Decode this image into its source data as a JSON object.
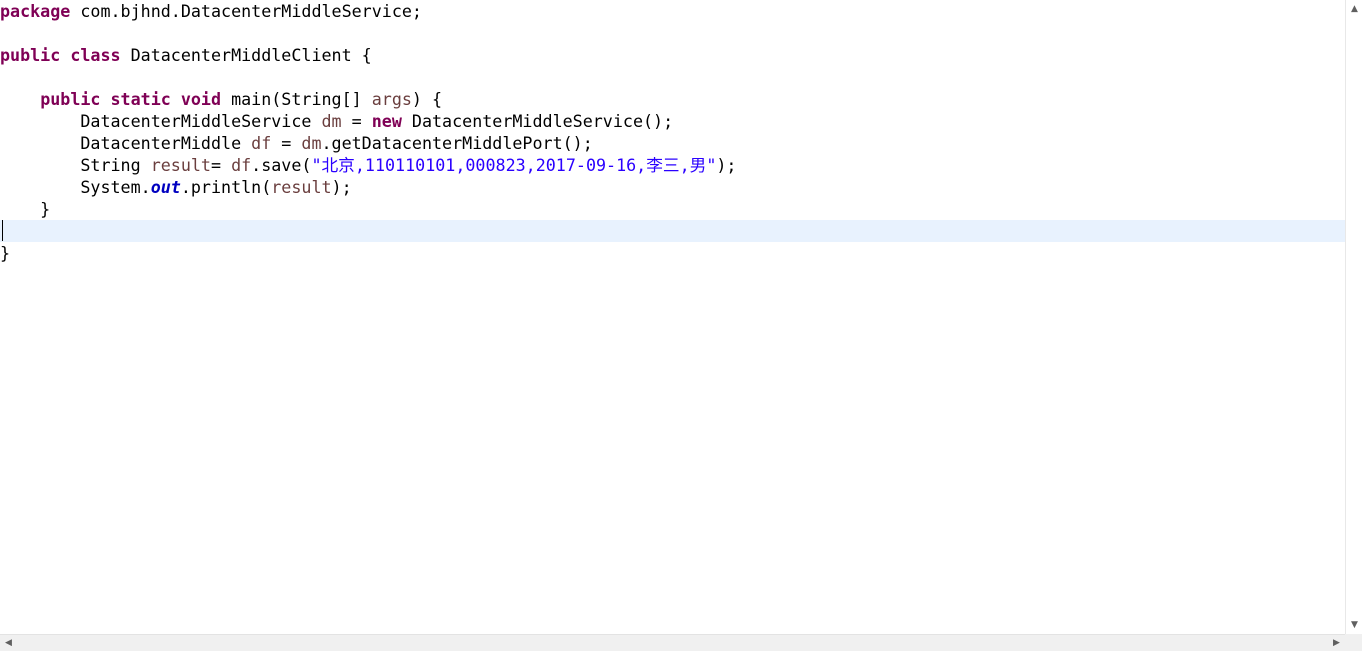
{
  "code": {
    "line1": {
      "kw": "package",
      "rest": " com.bjhnd.DatacenterMiddleService;"
    },
    "line3": {
      "kw1": "public",
      "kw2": "class",
      "rest": " DatacenterMiddleClient {"
    },
    "line5": {
      "indent": "    ",
      "kw1": "public",
      "kw2": "static",
      "kw3": "void",
      "mid": " main(String[] ",
      "var": "args",
      "end": ") {"
    },
    "line6": {
      "indent": "        ",
      "type": "DatacenterMiddleService ",
      "var": "dm",
      "eq": " = ",
      "kw": "new",
      "end": " DatacenterMiddleService();"
    },
    "line7": {
      "indent": "        ",
      "type": "DatacenterMiddle ",
      "var": "df",
      "eq": " = ",
      "var2": "dm",
      "end": ".getDatacenterMiddlePort();"
    },
    "line8": {
      "indent": "        ",
      "type": "String ",
      "var": "result",
      "eq": "= ",
      "var2": "df",
      "call": ".save(",
      "str": "\"北京,110110101,000823,2017-09-16,李三,男\"",
      "end": ");"
    },
    "line9": {
      "indent": "        ",
      "cls": "System.",
      "field": "out",
      "call": ".println(",
      "var": "result",
      "end": ");"
    },
    "line10": "    }",
    "line11": "",
    "line12": "}"
  },
  "scrollbars": {
    "up_arrow": "▲",
    "down_arrow": "▼",
    "left_arrow": "◀",
    "right_arrow": "▶"
  },
  "colors": {
    "keyword": "#7f0055",
    "local_variable": "#6a3e3e",
    "string": "#2a00ff",
    "static_field": "#0000c0",
    "current_line": "#e8f2fe"
  }
}
